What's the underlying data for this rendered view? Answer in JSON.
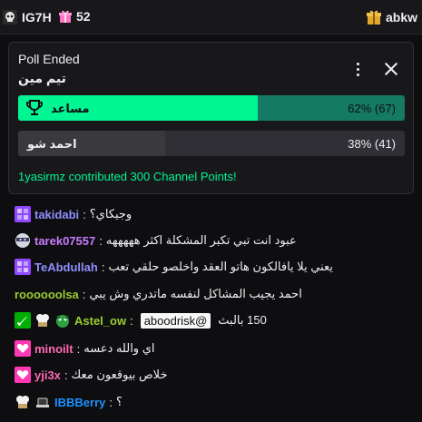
{
  "topbar": {
    "hype": [
      {
        "name": "IG7H",
        "icon": "skull-icon"
      },
      {
        "name": "52",
        "icon": "gift-icon"
      }
    ],
    "gifter": {
      "name": "abkw",
      "icon": "gift-icon"
    }
  },
  "poll": {
    "status": "Poll Ended",
    "title": "تيم مين",
    "options": [
      {
        "label": "مساعد",
        "result": "62% (67)",
        "percent": 62,
        "winner": true,
        "icon": "trophy-icon"
      },
      {
        "label": "احمد شو",
        "result": "38% (41)",
        "percent": 38,
        "winner": false
      }
    ],
    "contribution": "1yasirmz contributed 300 Channel Points!"
  },
  "chat": [
    {
      "user": "takidabi",
      "color": "#8f90ff",
      "badges": [
        "subscriber-badge"
      ],
      "text": "وجيكاي؟"
    },
    {
      "user": "tarek07557",
      "color": "#c87cff",
      "badges": [
        "ninja-badge"
      ],
      "text": "عبود انت تبي تكبر المشكلة اكثر هههههه"
    },
    {
      "user": "TeAbdullah",
      "color": "#8f90ff",
      "badges": [
        "subscriber-badge"
      ],
      "text": "يعني يلا يافالكون هاتو العقد واخلصو حلقي تعب"
    },
    {
      "user": "roooooolsa",
      "color": "#9acd32",
      "badges": [],
      "text": "احمد يجيب المشاكل لنفسه ماتدري وش يبي"
    },
    {
      "user": "Astel_ow",
      "color": "#9acd32",
      "badges": [
        "sword-badge",
        "chef-badge",
        "dragon-badge"
      ],
      "mention": "aboodrisk@",
      "text": "150 بالبث"
    },
    {
      "user": "minoilt",
      "color": "#ff69b4",
      "badges": [
        "heart-badge"
      ],
      "text": "اي والله دعسه"
    },
    {
      "user": "yji3x",
      "color": "#ff69b4",
      "badges": [
        "heart-badge"
      ],
      "text": "خلاص بيوقعون معك"
    },
    {
      "user": "IBBBerry",
      "color": "#1e90ff",
      "badges": [
        "chef-badge",
        "hat-badge"
      ],
      "text": "؟"
    }
  ],
  "colors": {
    "accent": "#00f593",
    "accent_dim": "#00b894",
    "panel": "#18181b",
    "track": "#2f2f35"
  }
}
